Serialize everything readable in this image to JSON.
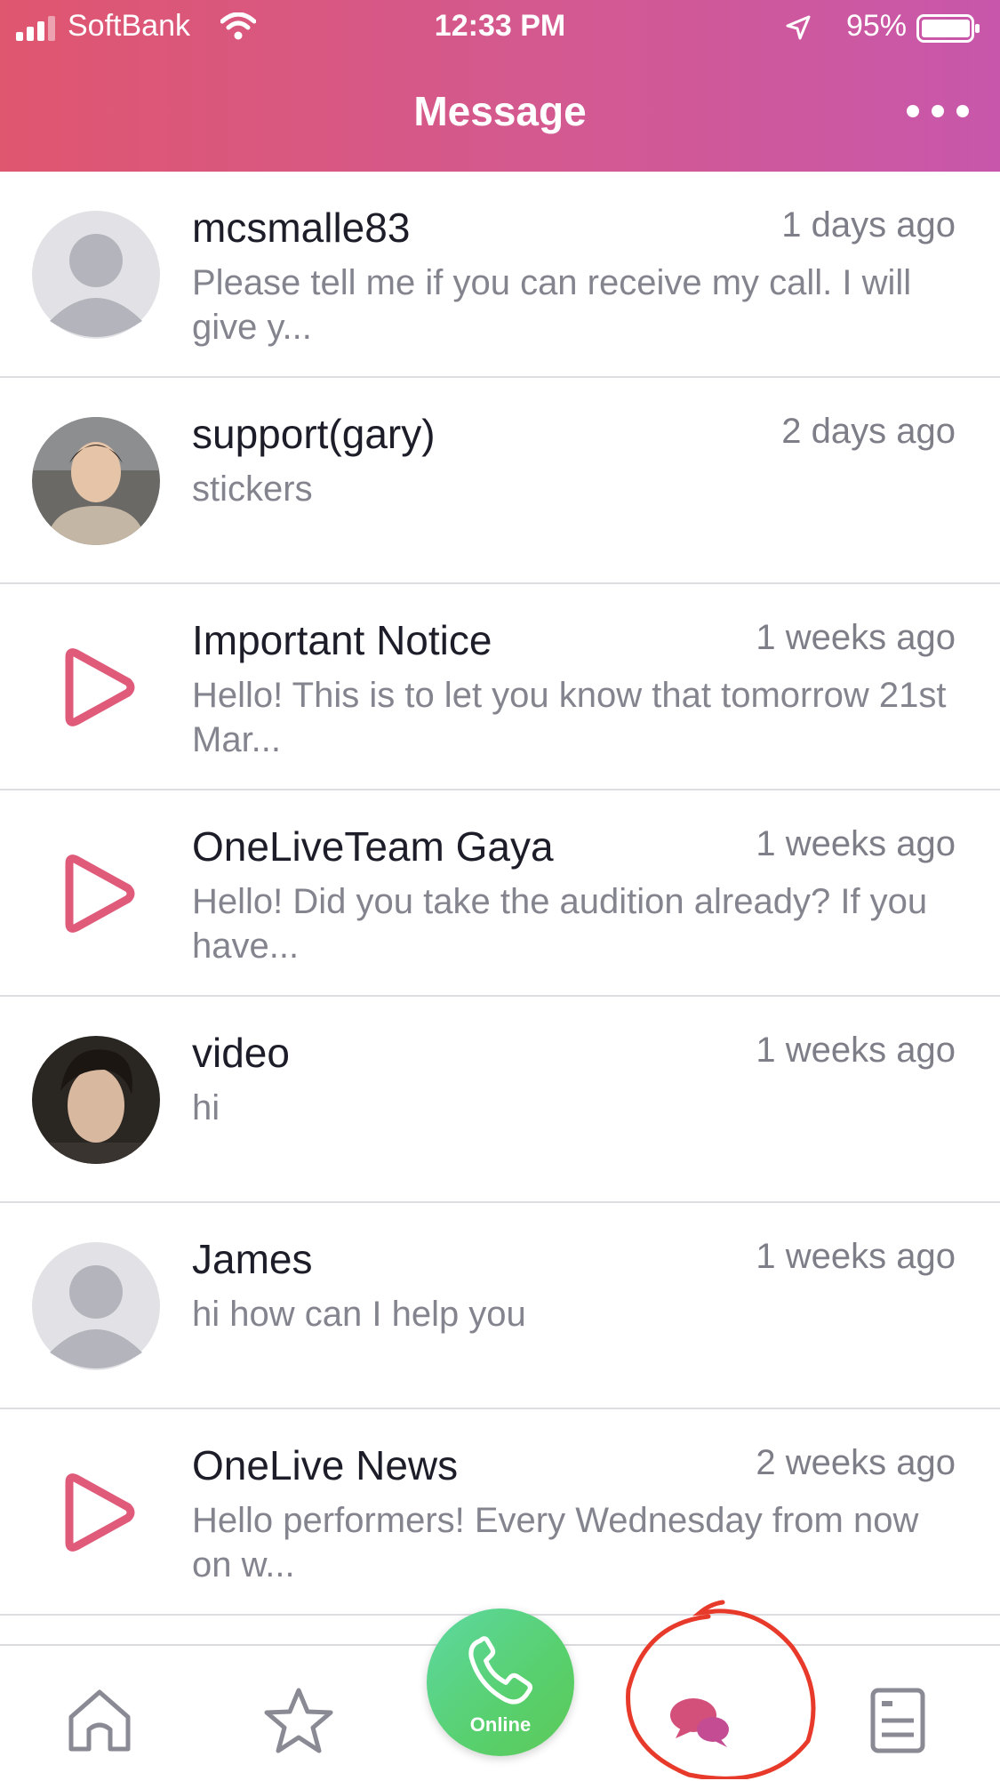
{
  "status_bar": {
    "carrier": "SoftBank",
    "time": "12:33 PM",
    "battery": "95%"
  },
  "header": {
    "title": "Message"
  },
  "messages": [
    {
      "name": "mcsmalle83",
      "time": "1 days ago",
      "preview": "Please tell me if you can receive my call. I will give y...",
      "avatar": "default-avatar"
    },
    {
      "name": "support(gary)",
      "time": "2 days ago",
      "preview": "stickers",
      "avatar": "photo-avatar"
    },
    {
      "name": "Important Notice",
      "time": "1 weeks ago",
      "preview": "Hello! This is to let you know that tomorrow 21st Mar...",
      "avatar": "play-logo"
    },
    {
      "name": "OneLiveTeam Gaya",
      "time": "1 weeks ago",
      "preview": "Hello! Did you take the audition already? If you have...",
      "avatar": "play-logo"
    },
    {
      "name": "video",
      "time": "1 weeks ago",
      "preview": "hi",
      "avatar": "photo-avatar"
    },
    {
      "name": "James",
      "time": "1 weeks ago",
      "preview": "hi how can I help you",
      "avatar": "default-avatar"
    },
    {
      "name": "OneLive News",
      "time": "2 weeks ago",
      "preview": "Hello performers! Every Wednesday from now on w...",
      "avatar": "play-logo"
    }
  ],
  "tabbar": {
    "call_label": "Online",
    "tabs": [
      "home-icon",
      "star-icon",
      "phone-icon",
      "chat-bubbles-icon",
      "document-icon"
    ]
  },
  "colors": {
    "header_start": "#df566f",
    "header_end": "#c857ab",
    "accent": "#e05a7a",
    "online": "#58d06e",
    "annotation": "#e83a2a"
  }
}
